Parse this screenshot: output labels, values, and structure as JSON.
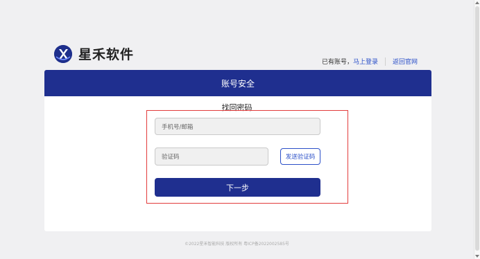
{
  "header": {
    "logo_text": "星禾软件",
    "have_account": "已有账号，",
    "login_link": "马上登录",
    "home_link": "返回官网"
  },
  "card": {
    "title": "账号安全",
    "subtitle": "找回密码"
  },
  "form": {
    "phone_placeholder": "手机号/邮箱",
    "code_placeholder": "验证码",
    "send_code_label": "发送验证码",
    "next_label": "下一步"
  },
  "footer": {
    "text": "©2022星禾智能科技  版权所有  粤ICP备2022002585号"
  },
  "colors": {
    "brand": "#1f2f8f",
    "link": "#2a4fc8",
    "highlight_frame": "#e23b3b"
  },
  "icons": {
    "logo": "xinghe-logo-icon"
  }
}
